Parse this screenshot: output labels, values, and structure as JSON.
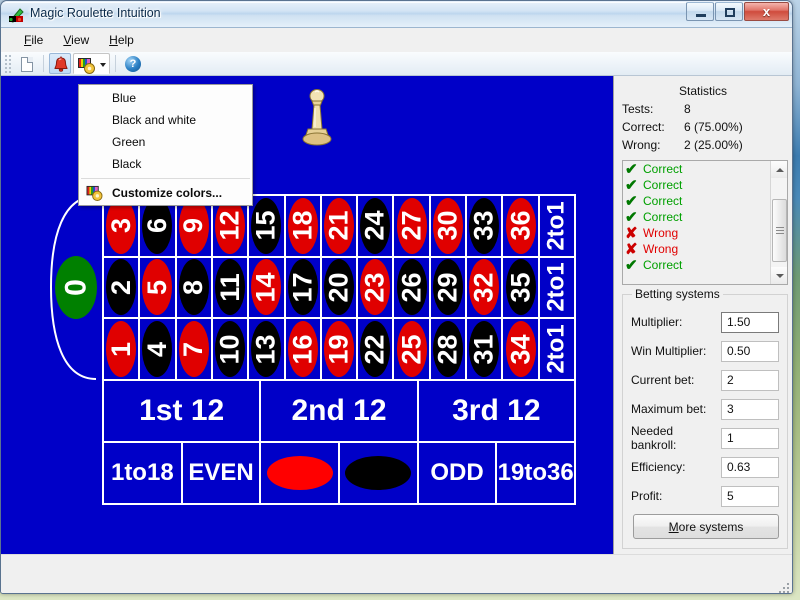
{
  "window": {
    "title": "Magic Roulette Intuition",
    "app_icon": "roulette-app-icon",
    "minimize_label": "",
    "maximize_label": "",
    "close_label": "x"
  },
  "menubar": {
    "items": [
      {
        "label": "File",
        "accel": "F"
      },
      {
        "label": "View",
        "accel": "V"
      },
      {
        "label": "Help",
        "accel": "H"
      }
    ]
  },
  "toolbar": {
    "new_icon": "new-document-icon",
    "bell_icon": "bell-icon",
    "palette_icon": "color-palette-icon",
    "dropdown_arrow_icon": "chevron-down-icon",
    "help_icon": "help-question-icon",
    "help_glyph": "?"
  },
  "color_dropdown": {
    "open": true,
    "items": [
      {
        "label": "Blue"
      },
      {
        "label": "Black and white"
      },
      {
        "label": "Green"
      },
      {
        "label": "Black"
      }
    ],
    "customize": {
      "label": "Customize colors...",
      "icon": "color-palette-icon"
    }
  },
  "board": {
    "background_color": "#0000c8",
    "line_color": "#ffffff",
    "pawn_icon": "chess-pawn-piece",
    "zero": {
      "label": "0",
      "color": "#008000"
    },
    "numbers": [
      {
        "n": "3",
        "c": "red"
      },
      {
        "n": "6",
        "c": "black"
      },
      {
        "n": "9",
        "c": "red"
      },
      {
        "n": "12",
        "c": "red"
      },
      {
        "n": "15",
        "c": "black"
      },
      {
        "n": "18",
        "c": "red"
      },
      {
        "n": "21",
        "c": "red"
      },
      {
        "n": "24",
        "c": "black"
      },
      {
        "n": "27",
        "c": "red"
      },
      {
        "n": "30",
        "c": "red"
      },
      {
        "n": "33",
        "c": "black"
      },
      {
        "n": "36",
        "c": "red"
      },
      {
        "n": "2",
        "c": "black"
      },
      {
        "n": "5",
        "c": "red"
      },
      {
        "n": "8",
        "c": "black"
      },
      {
        "n": "11",
        "c": "black"
      },
      {
        "n": "14",
        "c": "red"
      },
      {
        "n": "17",
        "c": "black"
      },
      {
        "n": "20",
        "c": "black"
      },
      {
        "n": "23",
        "c": "red"
      },
      {
        "n": "26",
        "c": "black"
      },
      {
        "n": "29",
        "c": "black"
      },
      {
        "n": "32",
        "c": "red"
      },
      {
        "n": "35",
        "c": "black"
      },
      {
        "n": "1",
        "c": "red"
      },
      {
        "n": "4",
        "c": "black"
      },
      {
        "n": "7",
        "c": "red"
      },
      {
        "n": "10",
        "c": "black"
      },
      {
        "n": "13",
        "c": "black"
      },
      {
        "n": "16",
        "c": "red"
      },
      {
        "n": "19",
        "c": "red"
      },
      {
        "n": "22",
        "c": "black"
      },
      {
        "n": "25",
        "c": "red"
      },
      {
        "n": "28",
        "c": "black"
      },
      {
        "n": "31",
        "c": "black"
      },
      {
        "n": "34",
        "c": "red"
      }
    ],
    "column_bets": [
      "2to1",
      "2to1",
      "2to1"
    ],
    "dozens": [
      "1st 12",
      "2nd 12",
      "3rd 12"
    ],
    "outside": [
      {
        "label": "1to18",
        "kind": "text"
      },
      {
        "label": "EVEN",
        "kind": "text"
      },
      {
        "label": "",
        "kind": "swatch-red",
        "color": "#ff0000"
      },
      {
        "label": "",
        "kind": "swatch-black",
        "color": "#000000"
      },
      {
        "label": "ODD",
        "kind": "text"
      },
      {
        "label": "19to36",
        "kind": "text"
      }
    ]
  },
  "statistics": {
    "heading": "Statistics",
    "rows": [
      {
        "key": "Tests:",
        "value": "8"
      },
      {
        "key": "Correct:",
        "value": "6 (75.00%)"
      },
      {
        "key": "Wrong:",
        "value": "2 (25.00%)"
      }
    ],
    "results": [
      {
        "label": "Correct",
        "status": "ok",
        "mark": "✔"
      },
      {
        "label": "Correct",
        "status": "ok",
        "mark": "✔"
      },
      {
        "label": "Correct",
        "status": "ok",
        "mark": "✔"
      },
      {
        "label": "Correct",
        "status": "ok",
        "mark": "✔"
      },
      {
        "label": "Wrong",
        "status": "no",
        "mark": "✘"
      },
      {
        "label": "Wrong",
        "status": "no",
        "mark": "✘"
      },
      {
        "label": "Correct",
        "status": "ok",
        "mark": "✔"
      }
    ],
    "colors": {
      "correct": "#00a000",
      "wrong": "#e00000"
    }
  },
  "betting_systems": {
    "legend": "Betting systems",
    "fields": [
      {
        "label": "Multiplier:",
        "value": "1.50",
        "focused": true
      },
      {
        "label": "Win Multiplier:",
        "value": "0.50",
        "focused": false
      },
      {
        "label": "Current bet:",
        "value": "2",
        "focused": false
      },
      {
        "label": "Maximum bet:",
        "value": "3",
        "focused": false
      },
      {
        "label": "Needed bankroll:",
        "value": "1",
        "focused": false
      },
      {
        "label": "Efficiency:",
        "value": "0.63",
        "focused": false
      },
      {
        "label": "Profit:",
        "value": "5",
        "focused": false
      }
    ],
    "more_button": {
      "label": "More systems",
      "accel": "M"
    }
  }
}
